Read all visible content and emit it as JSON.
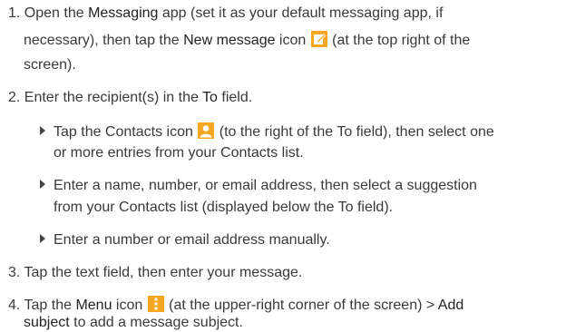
{
  "step1": {
    "line1_a": "1. Open the ",
    "line1_b": "Messaging",
    "line1_c": " app (set it as your default messaging app, if",
    "line2_a": "necessary), then tap the ",
    "line2_b": "New message",
    "line2_c": " icon ",
    "line2_d": " (at the top right of the",
    "line3": "screen)."
  },
  "step2": {
    "line1_a": "2. Enter the recipient(s) in the ",
    "line1_b": "To",
    "line1_c": " field."
  },
  "bullets": {
    "b1_line1_a": "Tap the Contacts icon ",
    "b1_line1_b": " (to the right of the To field), then select one",
    "b1_line2": "or more entries from your Contacts list.",
    "b2_line1": "Enter a name, number, or email address, then select a suggestion",
    "b2_line2": "from your Contacts list (displayed below the To field).",
    "b3_line1": "Enter a number or email address manually."
  },
  "step3": {
    "line1": "3. Tap the text field, then enter your message."
  },
  "step4": {
    "line1_a": "4. Tap the ",
    "line1_b": "Menu",
    "line1_c": " icon ",
    "line1_d": " (at the upper-right corner of the screen) > ",
    "line1_e": "Add",
    "line2_a": "subject",
    "line2_b": " to add a message subject."
  },
  "colors": {
    "icon_accent": "#f5a623",
    "text": "#3a3a3a"
  },
  "icons": {
    "new_message": "compose-icon",
    "contacts": "contact-person-icon",
    "menu": "vertical-dots-menu-icon"
  }
}
